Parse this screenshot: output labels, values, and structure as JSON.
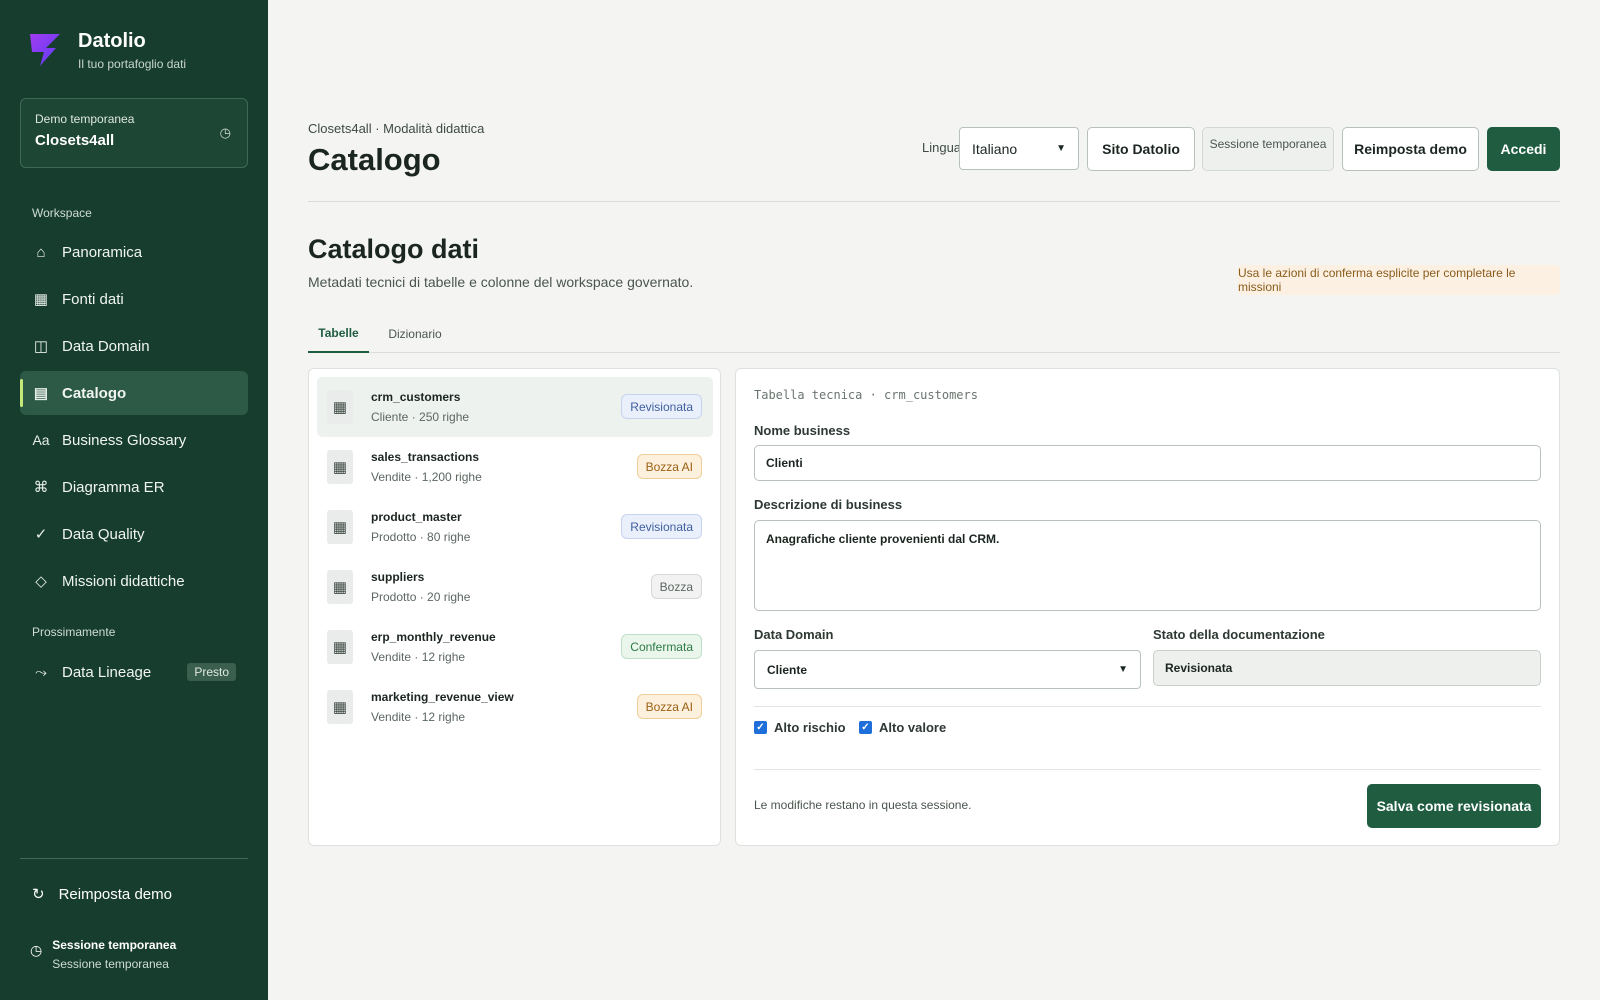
{
  "brand": {
    "name": "Datolio",
    "tagline": "Il tuo portafoglio dati"
  },
  "demo_card": {
    "label": "Demo temporanea",
    "value": "Closets4all",
    "icon": "clock-icon"
  },
  "sidebar": {
    "workspace_label": "Workspace",
    "items": [
      {
        "label": "Panoramica",
        "icon": "home-icon"
      },
      {
        "label": "Fonti dati",
        "icon": "grid-icon"
      },
      {
        "label": "Data Domain",
        "icon": "columns-icon"
      },
      {
        "label": "Catalogo",
        "icon": "list-icon",
        "active": true
      },
      {
        "label": "Business Glossary",
        "icon": "text-icon"
      },
      {
        "label": "Diagramma ER",
        "icon": "command-icon"
      },
      {
        "label": "Data Quality",
        "icon": "check-icon"
      },
      {
        "label": "Missioni didattiche",
        "icon": "diamond-icon"
      }
    ],
    "soon_label": "Prossimamente",
    "soon_items": [
      {
        "label": "Data Lineage",
        "icon": "trend-icon",
        "badge": "Presto"
      }
    ],
    "reset_label": "Reimposta demo",
    "session_title": "Sessione temporanea",
    "session_sub": "Sessione temporanea"
  },
  "header": {
    "breadcrumb": "Closets4all · Modalità didattica",
    "title": "Catalogo",
    "language_label": "Lingua",
    "language_value": "Italiano",
    "site_button": "Sito Datolio",
    "session_chip": "Sessione temporanea",
    "reset_button": "Reimposta demo",
    "login_button": "Accedi"
  },
  "section": {
    "title": "Catalogo dati",
    "subtitle": "Metadati tecnici di tabelle e colonne del workspace governato.",
    "notice": "Usa le azioni di conferma esplicite per completare le missioni"
  },
  "tabs": [
    {
      "label": "Tabelle",
      "active": true
    },
    {
      "label": "Dizionario"
    }
  ],
  "tables": [
    {
      "name": "crm_customers",
      "meta": "Cliente · 250 righe",
      "status": "Revisionata",
      "status_kind": "rev",
      "selected": true
    },
    {
      "name": "sales_transactions",
      "meta": "Vendite · 1,200 righe",
      "status": "Bozza AI",
      "status_kind": "ai"
    },
    {
      "name": "product_master",
      "meta": "Prodotto · 80 righe",
      "status": "Revisionata",
      "status_kind": "rev"
    },
    {
      "name": "suppliers",
      "meta": "Prodotto · 20 righe",
      "status": "Bozza",
      "status_kind": "draft"
    },
    {
      "name": "erp_monthly_revenue",
      "meta": "Vendite · 12 righe",
      "status": "Confermata",
      "status_kind": "conf"
    },
    {
      "name": "marketing_revenue_view",
      "meta": "Vendite · 12 righe",
      "status": "Bozza AI",
      "status_kind": "ai"
    }
  ],
  "detail": {
    "technical_label": "Tabella tecnica · crm_customers",
    "business_name_label": "Nome business",
    "business_name_value": "Clienti",
    "description_label": "Descrizione di business",
    "description_value": "Anagrafiche cliente provenienti dal CRM.",
    "domain_label": "Data Domain",
    "domain_value": "Cliente",
    "doc_status_label": "Stato della documentazione",
    "doc_status_value": "Revisionata",
    "high_risk_label": "Alto rischio",
    "high_risk_checked": true,
    "high_value_label": "Alto valore",
    "high_value_checked": true,
    "footer_note": "Le modifiche restano in questa sessione.",
    "save_button": "Salva come revisionata"
  },
  "colors": {
    "sidebar_bg": "#173d2e",
    "accent": "#1f5c40",
    "logo": "#7b3ff2"
  }
}
